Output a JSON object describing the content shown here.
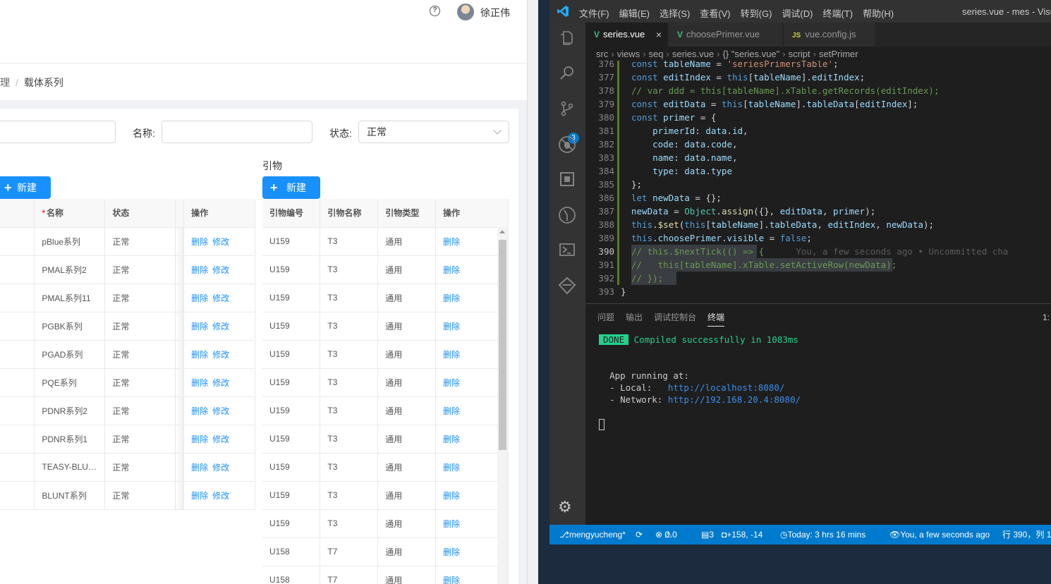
{
  "web": {
    "user_name": "徐正伟",
    "help_icon_glyph": "?",
    "breadcrumb": {
      "parent": "理",
      "separator": "/",
      "current": "载体系列"
    },
    "filters": {
      "first_value": "",
      "name_label": "名称:",
      "name_value": "",
      "status_label": "状态:",
      "status_value": "正常"
    },
    "left_table": {
      "new_button": "新建",
      "headers": [
        "名称",
        "状态",
        "操作"
      ],
      "required_mark": "*",
      "rows": [
        {
          "name": "pBlue系列",
          "status": "正常"
        },
        {
          "name": "PMAL系列2",
          "status": "正常"
        },
        {
          "name": "PMAL系列11",
          "status": "正常"
        },
        {
          "name": "PGBK系列",
          "status": "正常"
        },
        {
          "name": "PGAD系列",
          "status": "正常"
        },
        {
          "name": "PQE系列",
          "status": "正常"
        },
        {
          "name": "PDNR系列2",
          "status": "正常"
        },
        {
          "name": "PDNR系列1",
          "status": "正常"
        },
        {
          "name": "TEASY-BLU…",
          "status": "正常"
        },
        {
          "name": "BLUNT系列",
          "status": "正常"
        }
      ],
      "delete_label": "删除",
      "edit_label": "修改"
    },
    "right_table": {
      "section_label": "引物",
      "new_button": "新建",
      "headers": [
        "引物编号",
        "引物名称",
        "引物类型",
        "操作"
      ],
      "rows": [
        {
          "code": "U159",
          "name": "T3",
          "type": "通用"
        },
        {
          "code": "U159",
          "name": "T3",
          "type": "通用"
        },
        {
          "code": "U159",
          "name": "T3",
          "type": "通用"
        },
        {
          "code": "U159",
          "name": "T3",
          "type": "通用"
        },
        {
          "code": "U159",
          "name": "T3",
          "type": "通用"
        },
        {
          "code": "U159",
          "name": "T3",
          "type": "通用"
        },
        {
          "code": "U159",
          "name": "T3",
          "type": "通用"
        },
        {
          "code": "U159",
          "name": "T3",
          "type": "通用"
        },
        {
          "code": "U159",
          "name": "T3",
          "type": "通用"
        },
        {
          "code": "U159",
          "name": "T3",
          "type": "通用"
        },
        {
          "code": "U159",
          "name": "T3",
          "type": "通用"
        },
        {
          "code": "U158",
          "name": "T7",
          "type": "通用"
        },
        {
          "code": "U158",
          "name": "T7",
          "type": "通用"
        }
      ],
      "delete_label": "删除"
    },
    "accent_color": "#1890ff"
  },
  "vscode": {
    "menu": [
      "文件(F)",
      "编辑(E)",
      "选择(S)",
      "查看(V)",
      "转到(G)",
      "调试(D)",
      "终端(T)",
      "帮助(H)"
    ],
    "window_title": "series.vue - mes - Visual",
    "tabs": [
      "series.vue",
      "choosePrimer.vue",
      "vue.config.js"
    ],
    "tab_close_glyph": "×",
    "tab_icons": [
      "vue-icon",
      "vue-icon",
      "js-icon"
    ],
    "breadcrumb": [
      "src",
      "views",
      "seq",
      "series.vue",
      "{} \"series.vue\"",
      "script",
      "setPrimer"
    ],
    "line_numbers": [
      "376",
      "377",
      "378",
      "379",
      "380",
      "381",
      "382",
      "383",
      "384",
      "385",
      "386",
      "387",
      "388",
      "389",
      "390",
      "391",
      "392",
      "393"
    ],
    "current_line": "390",
    "scm_badge": "3",
    "blame_text": "You, a few seconds ago • Uncommitted cha",
    "panel_tabs": [
      "问题",
      "输出",
      "调试控制台",
      "终端"
    ],
    "panel_active": "终端",
    "panel_number": "1:",
    "terminal": {
      "done_badge": "DONE",
      "compiled": "Compiled successfully in 1083ms",
      "app_running": "App running at:",
      "local_label": "- Local:   ",
      "local_url": "http://localhost:8080/",
      "network_label": "- Network: ",
      "network_url": "http://192.168.20.4:8080/"
    },
    "status": {
      "branch": "mengyucheng*",
      "errors": "0",
      "warnings": "0",
      "changes": "3",
      "diff": "+158, -14",
      "time": "Today: 3 hrs 16 mins",
      "blame": "You, a few seconds ago",
      "position": "行 390，列 1"
    },
    "status_color": "#007acc"
  }
}
